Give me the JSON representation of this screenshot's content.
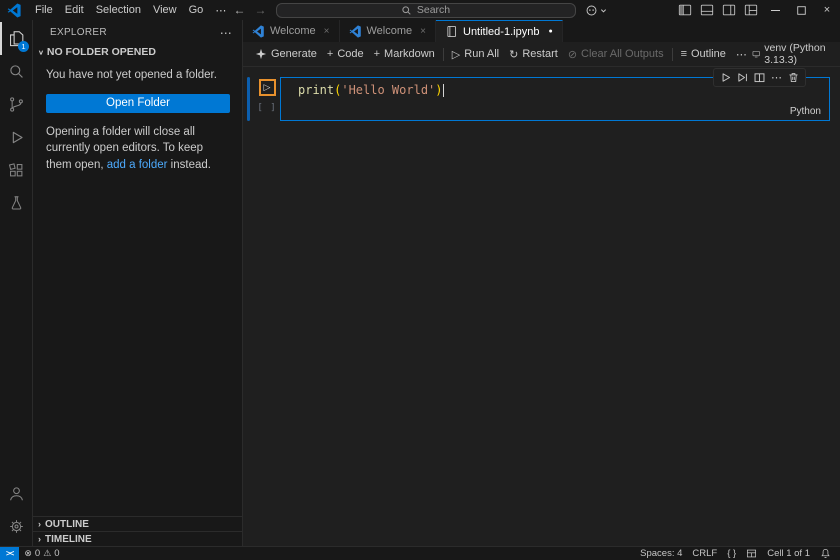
{
  "glyphs": {
    "more": "⋯",
    "back": "←",
    "forward": "→",
    "chevron_down": "∨",
    "chevron_right": "›",
    "plus": "+",
    "run": "▷",
    "restart": "↻",
    "clear": "⊘",
    "outline": "≡",
    "dot": "●",
    "close": "×",
    "error": "⊗",
    "warning": "⚠",
    "braces": "{ }",
    "remote": "><"
  },
  "title_bar": {
    "menus": [
      "File",
      "Edit",
      "Selection",
      "View",
      "Go"
    ],
    "search_placeholder": "Search"
  },
  "activity_bar": {
    "explorer_badge": "1"
  },
  "sidebar": {
    "title": "EXPLORER",
    "section_title": "NO FOLDER OPENED",
    "empty_message": "You have not yet opened a folder.",
    "open_folder_label": "Open Folder",
    "hint_before_link": "Opening a folder will close all currently open editors. To keep them open, ",
    "hint_link": "add a folder",
    "hint_after_link": " instead.",
    "outline_label": "OUTLINE",
    "timeline_label": "TIMELINE"
  },
  "tabs": [
    {
      "label": "Welcome"
    },
    {
      "label": "Welcome"
    },
    {
      "label": "Untitled-1.ipynb"
    }
  ],
  "notebook_toolbar": {
    "generate_label": "Generate",
    "code_label": "Code",
    "markdown_label": "Markdown",
    "run_all_label": "Run All",
    "restart_label": "Restart",
    "clear_outputs_label": "Clear All Outputs",
    "outline_label": "Outline",
    "kernel_label": "venv (Python 3.13.3)"
  },
  "cell": {
    "execution_count": "[ ]",
    "code_function": "print",
    "code_open_paren": "(",
    "code_string": "'Hello World'",
    "code_close_paren": ")",
    "language_label": "Python"
  },
  "status_bar": {
    "error_count": "0",
    "warning_count": "0",
    "spaces_label": "Spaces: 4",
    "eol_label": "CRLF",
    "cell_position_label": "Cell 1 of 1"
  }
}
